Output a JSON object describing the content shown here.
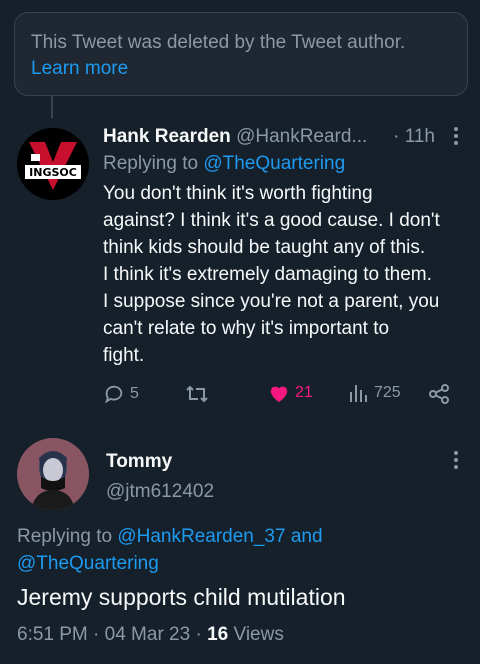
{
  "deleted_notice": {
    "text": "This Tweet was deleted by the Tweet author.",
    "link": "Learn more"
  },
  "reply": {
    "name": "Hank Rearden",
    "handle": "@HankReard...",
    "time": "· 11h",
    "avatar_text": "INGSOC",
    "replying_prefix": "Replying to ",
    "replying_to": "@TheQuartering",
    "text_lines": [
      "You don't think it's worth fighting",
      "against? I think it's a good cause. I don't",
      "think kids should be taught any of this.",
      "I think it's extremely damaging to them.",
      "I suppose since you're not a parent, you",
      "can't relate to why it's important to",
      "fight."
    ],
    "replies": "5",
    "retweets": "",
    "likes": "21",
    "views": "725",
    "like_color": "#f91880"
  },
  "main_tweet": {
    "name": "Tommy",
    "handle": "@jtm612402",
    "replying_prefix": "Replying to ",
    "mention1": "@HankRearden_37",
    "and": " and",
    "mention2": "@TheQuartering",
    "text": "Jeremy supports child mutilation",
    "time": "6:51 PM · 04 Mar 23 · ",
    "views_count": "16",
    "views_label": " Views"
  }
}
